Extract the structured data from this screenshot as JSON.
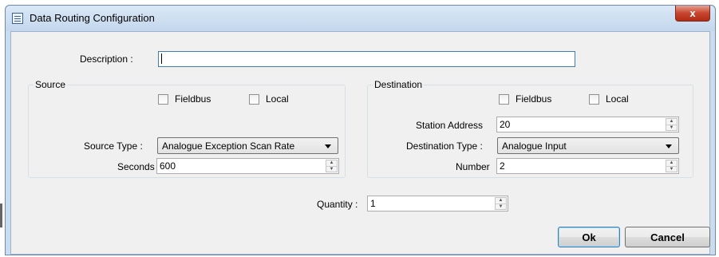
{
  "window": {
    "title": "Data Routing Configuration",
    "close_glyph": "x"
  },
  "description": {
    "label": "Description :",
    "value": ""
  },
  "source": {
    "title": "Source",
    "fieldbus_label": "Fieldbus",
    "fieldbus_checked": false,
    "local_label": "Local",
    "local_checked": false,
    "type_label": "Source Type :",
    "type_value": "Analogue Exception Scan Rate",
    "seconds_label": "Seconds",
    "seconds_value": "600"
  },
  "destination": {
    "title": "Destination",
    "fieldbus_label": "Fieldbus",
    "fieldbus_checked": false,
    "local_label": "Local",
    "local_checked": false,
    "station_label": "Station Address",
    "station_value": "20",
    "type_label": "Destination Type :",
    "type_value": "Analogue Input",
    "number_label": "Number",
    "number_value": "2"
  },
  "quantity": {
    "label": "Quantity :",
    "value": "1"
  },
  "buttons": {
    "ok": "Ok",
    "cancel": "Cancel"
  },
  "icons": [
    "app-icon",
    "close-icon",
    "spin-up-icon",
    "spin-down-icon",
    "dropdown-arrow-icon"
  ]
}
